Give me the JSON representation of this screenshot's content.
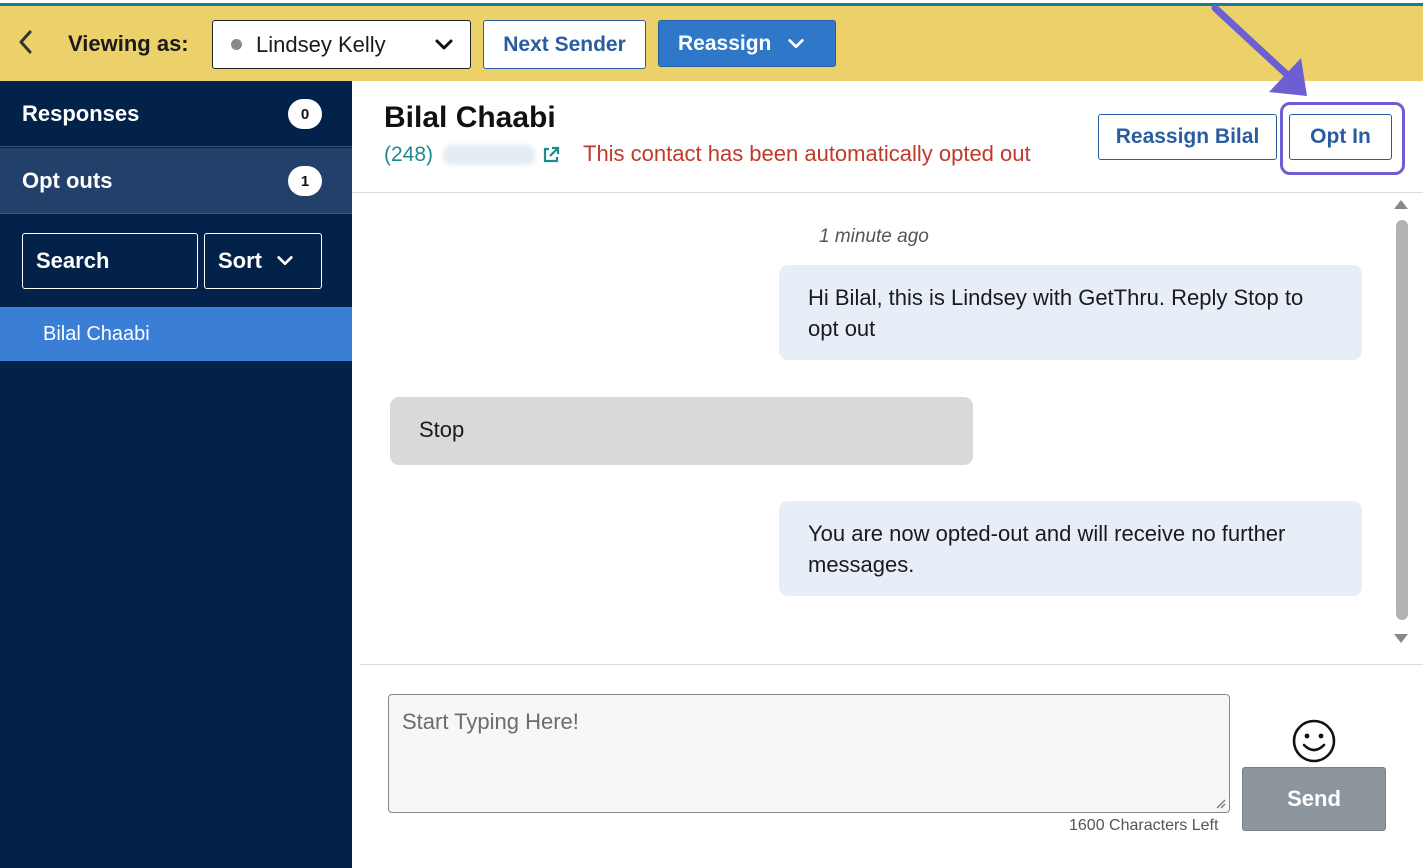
{
  "topbar": {
    "viewing_label": "Viewing as:",
    "sender_name": "Lindsey Kelly",
    "next_sender_label": "Next Sender",
    "reassign_label": "Reassign",
    "background_color": "#ecd06a"
  },
  "sidebar": {
    "items": [
      {
        "label": "Responses",
        "count": "0"
      },
      {
        "label": "Opt outs",
        "count": "1"
      }
    ],
    "search_label": "Search",
    "sort_label": "Sort",
    "contacts": [
      {
        "name": "Bilal Chaabi",
        "selected": true
      }
    ],
    "background_color": "#03224a",
    "selected_color": "#3a7ed6"
  },
  "contact": {
    "name": "Bilal Chaabi",
    "phone_area": "(248)",
    "status_message": "This contact has been automatically opted out",
    "reassign_label": "Reassign Bilal",
    "opt_in_label": "Opt In"
  },
  "conversation": {
    "timestamp": "1 minute ago",
    "messages": [
      {
        "direction": "outgoing",
        "text": "Hi Bilal, this is Lindsey with GetThru. Reply Stop to opt out"
      },
      {
        "direction": "incoming",
        "text": "Stop"
      },
      {
        "direction": "outgoing",
        "text": "You are now opted-out and will receive no further messages."
      }
    ]
  },
  "composer": {
    "placeholder": "Start Typing Here!",
    "value": "",
    "chars_left": "1600 Characters Left",
    "send_label": "Send"
  },
  "annotations": {
    "arrow_color": "#6b5fd3",
    "highlight_target": "Opt In"
  },
  "icons": {
    "back": "chevron-left-icon",
    "dropdown": "chevron-down-icon",
    "external_link": "external-link-icon",
    "emoji": "smiley-face-icon"
  }
}
